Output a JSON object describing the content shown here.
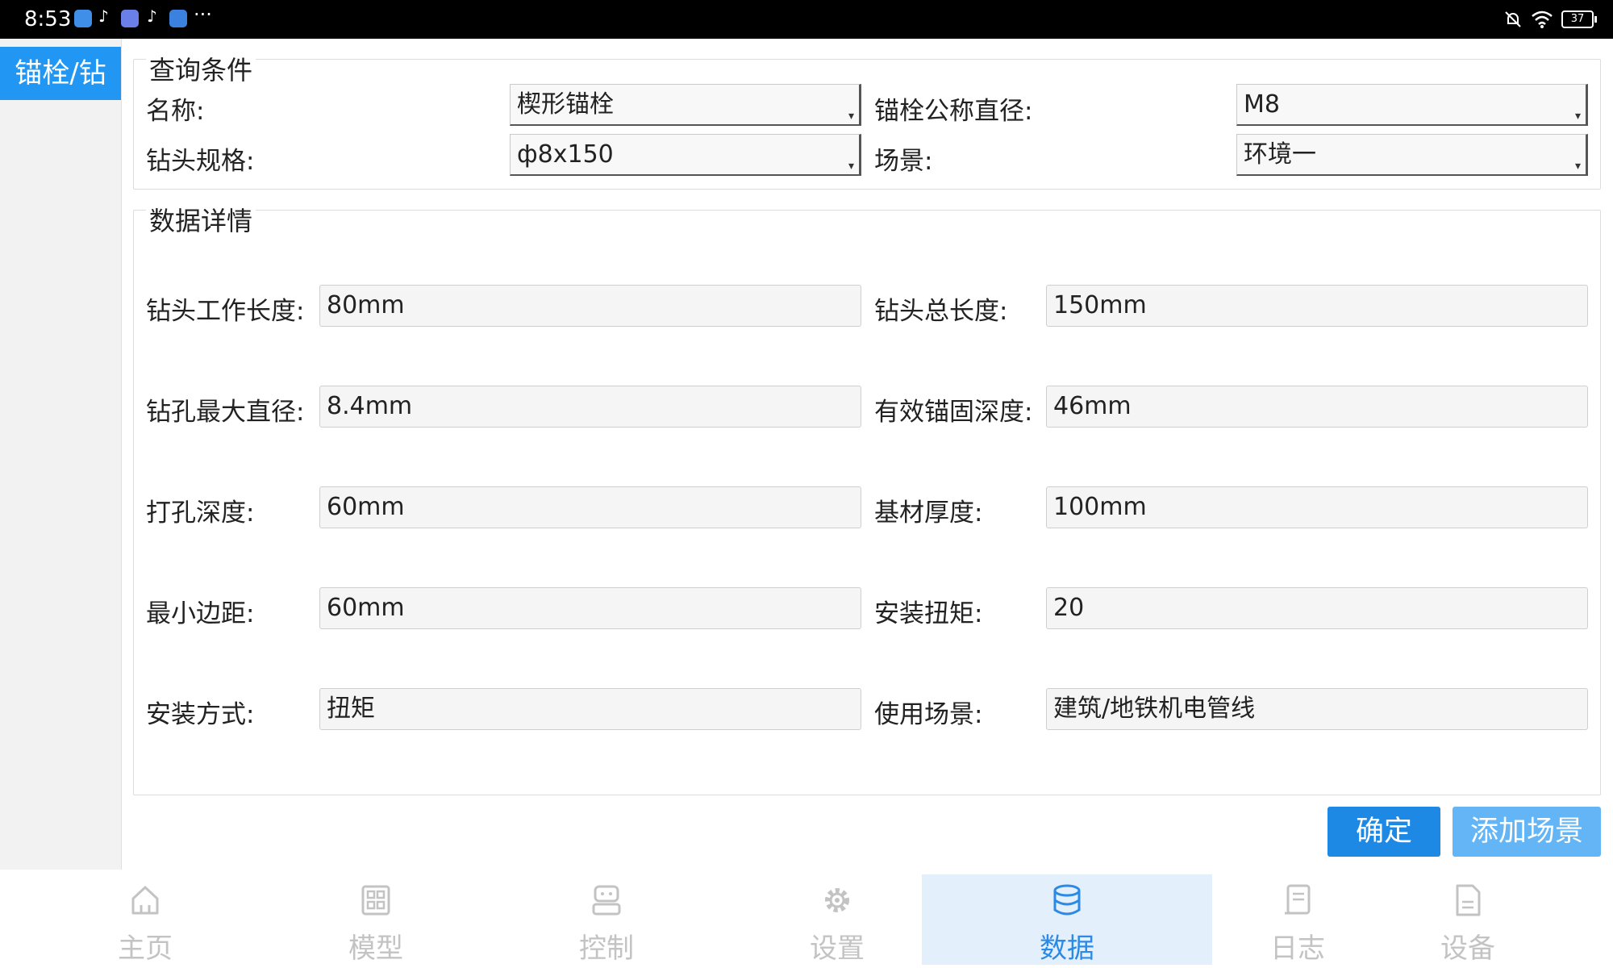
{
  "status_bar": {
    "time": "8:53",
    "more": "···",
    "battery": "37",
    "icons": [
      "app-icon-blue",
      "tiktok-icon",
      "app-icon-music",
      "tiktok-icon",
      "cloud-icon",
      "mute-icon",
      "wifi-icon",
      "battery-icon"
    ]
  },
  "sidebar": {
    "active_tab": "锚栓/钻"
  },
  "query": {
    "title": "查询条件",
    "name_label": "名称:",
    "name_value": "楔形锚栓",
    "diameter_label": "锚栓公称直径:",
    "diameter_value": "M8",
    "drill_label": "钻头规格:",
    "drill_value": "ф8x150",
    "scene_label": "场景:",
    "scene_value": "环境一"
  },
  "details": {
    "title": "数据详情",
    "rows": [
      {
        "l_label": "钻头工作长度:",
        "l_value": "80mm",
        "r_label": "钻头总长度:",
        "r_value": "150mm"
      },
      {
        "l_label": "钻孔最大直径:",
        "l_value": "8.4mm",
        "r_label": "有效锚固深度:",
        "r_value": "46mm"
      },
      {
        "l_label": "打孔深度:",
        "l_value": "60mm",
        "r_label": "基材厚度:",
        "r_value": "100mm"
      },
      {
        "l_label": "最小边距:",
        "l_value": "60mm",
        "r_label": "安装扭矩:",
        "r_value": "20"
      },
      {
        "l_label": "安装方式:",
        "l_value": "扭矩",
        "r_label": "使用场景:",
        "r_value": "建筑/地铁机电管线"
      }
    ]
  },
  "buttons": {
    "confirm": "确定",
    "add_scene": "添加场景"
  },
  "bottom_nav": {
    "active": "数据",
    "items": [
      {
        "label": "主页",
        "icon": "home-icon"
      },
      {
        "label": "模型",
        "icon": "grid-icon"
      },
      {
        "label": "控制",
        "icon": "control-icon"
      },
      {
        "label": "设置",
        "icon": "gear-icon"
      },
      {
        "label": "数据",
        "icon": "database-icon"
      },
      {
        "label": "日志",
        "icon": "log-icon"
      },
      {
        "label": "设备",
        "icon": "device-icon"
      }
    ]
  },
  "colors": {
    "accent": "#2196F3",
    "button_primary": "#1e88e5",
    "button_secondary": "#64b5f6",
    "nav_inactive": "#c3c3c3",
    "nav_active": "#2b8ae6"
  }
}
